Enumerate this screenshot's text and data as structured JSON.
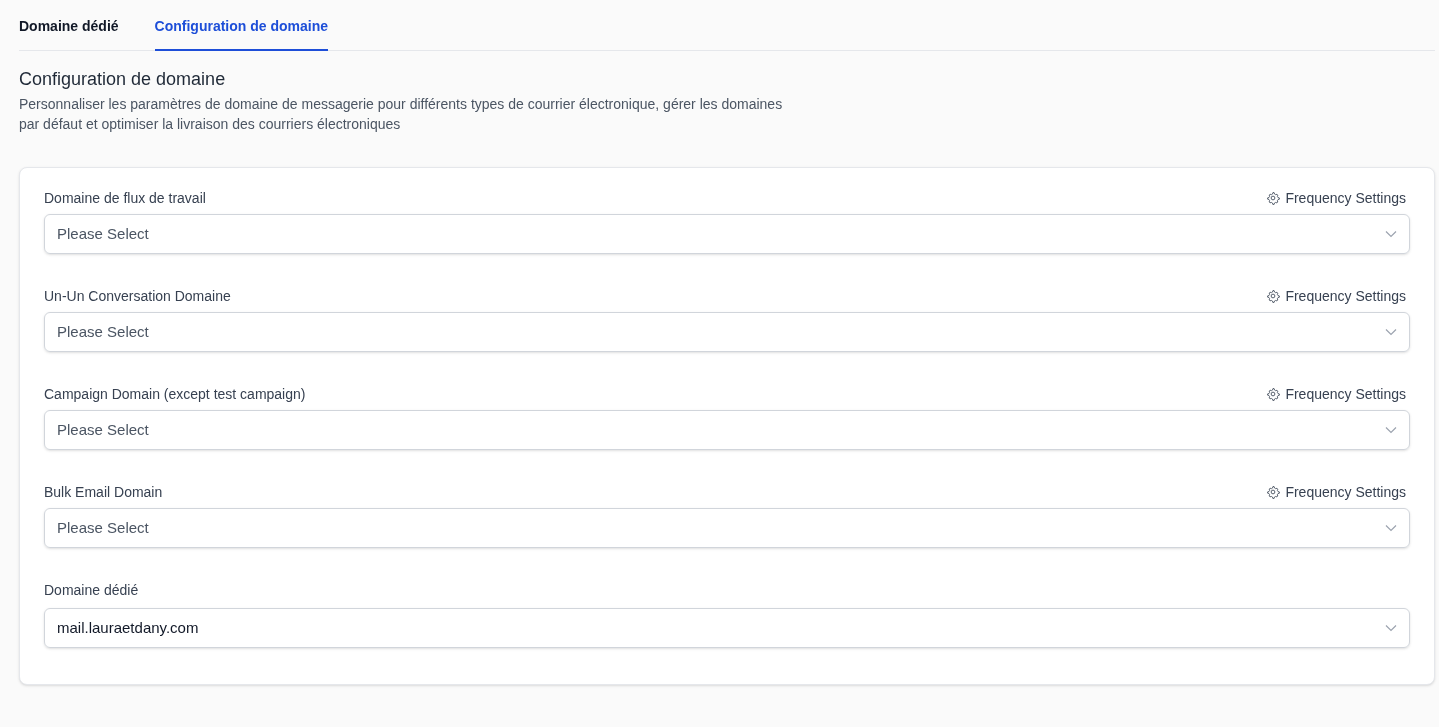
{
  "tabs": [
    {
      "label": "Domaine dédié",
      "selected": false
    },
    {
      "label": "Configuration de domaine",
      "selected": true
    }
  ],
  "header": {
    "title": "Configuration de domaine",
    "description": "Personnaliser les paramètres de domaine de messagerie pour différents types de courrier électronique, gérer les domaines par défaut et optimiser la livraison des courriers électroniques"
  },
  "fields": [
    {
      "label": "Domaine de flux de travail",
      "action": "Frequency Settings",
      "placeholder": "Please Select"
    },
    {
      "label": "Un-Un Conversation Domaine",
      "action": "Frequency Settings",
      "placeholder": "Please Select"
    },
    {
      "label": "Campaign Domain (except test campaign)",
      "action": "Frequency Settings",
      "placeholder": "Please Select"
    },
    {
      "label": "Bulk Email Domain",
      "action": "Frequency Settings",
      "placeholder": "Please Select"
    },
    {
      "label": "Domaine dédié",
      "value": "mail.lauraetdany.com"
    }
  ]
}
